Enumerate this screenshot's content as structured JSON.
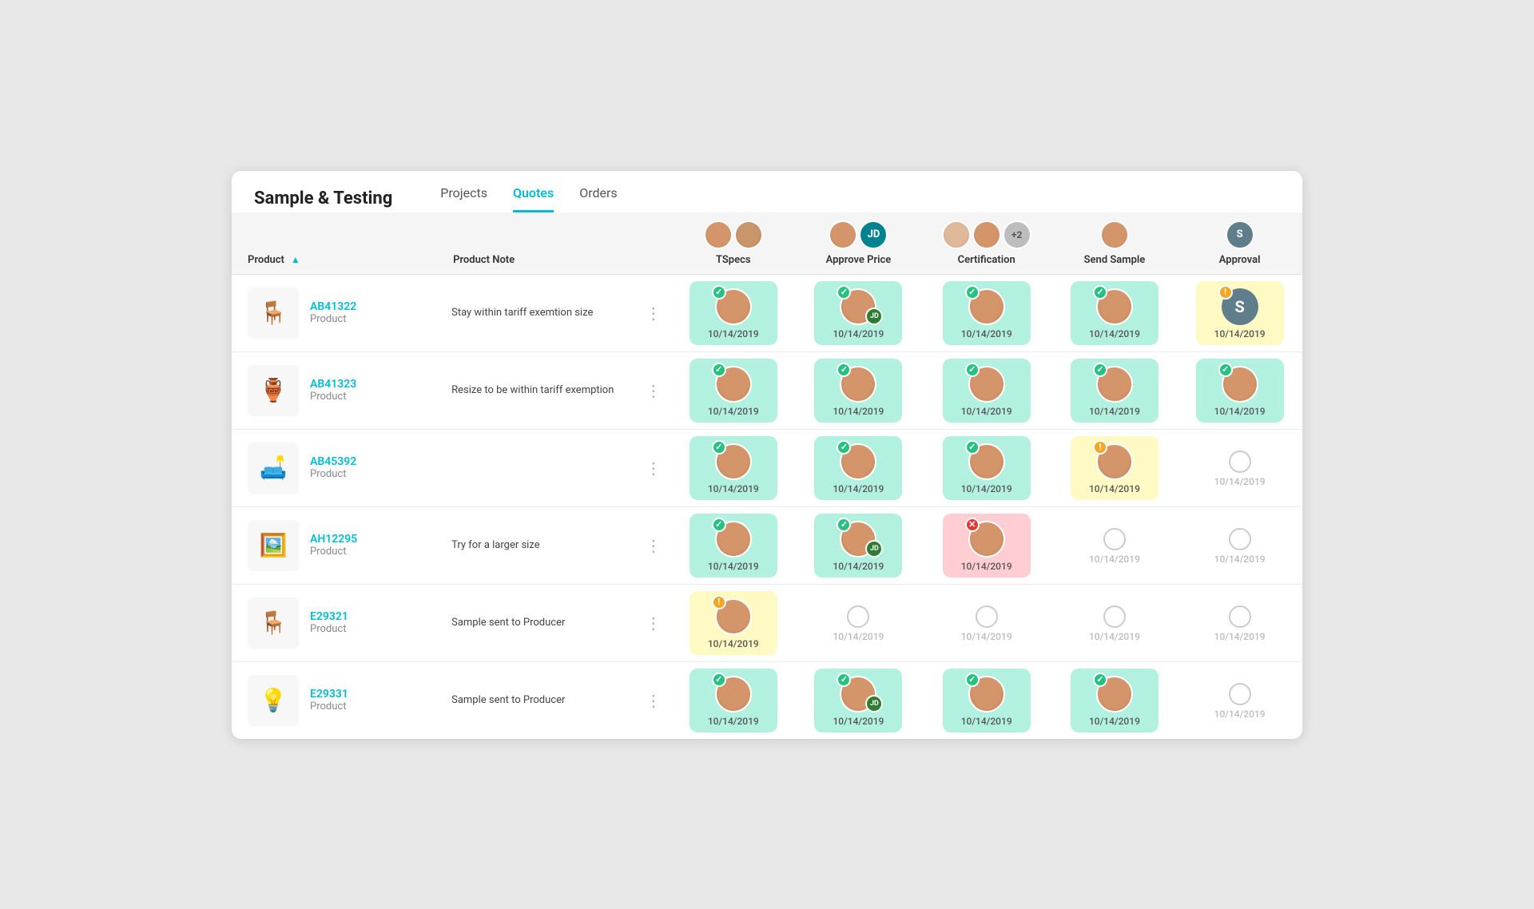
{
  "app": {
    "title": "Sample & Testing",
    "nav": [
      {
        "label": "Projects",
        "active": false
      },
      {
        "label": "Quotes",
        "active": true
      },
      {
        "label": "Orders",
        "active": false
      }
    ]
  },
  "columns": [
    {
      "key": "product",
      "label": "Product",
      "sortable": true
    },
    {
      "key": "note",
      "label": "Product Note"
    },
    {
      "key": "tspecs",
      "label": "TSpecs"
    },
    {
      "key": "approve_price",
      "label": "Approve Price"
    },
    {
      "key": "certification",
      "label": "Certification"
    },
    {
      "key": "send_sample",
      "label": "Send Sample"
    },
    {
      "key": "approval",
      "label": "Approval"
    }
  ],
  "date": "10/14/2019",
  "rows": [
    {
      "id": "AB41322",
      "type": "Product",
      "note": "Stay within tariff exemtion size",
      "icon": "🪑",
      "stages": {
        "tspecs": {
          "status": "done",
          "avatar": "woman1"
        },
        "approve_price": {
          "status": "done",
          "avatar": "woman1",
          "jd": true
        },
        "certification": {
          "status": "done",
          "avatar": "woman1"
        },
        "send_sample": {
          "status": "done",
          "avatar": "woman1"
        },
        "approval": {
          "status": "warn",
          "avatar": "s",
          "badge": "warn"
        }
      }
    },
    {
      "id": "AB41323",
      "type": "Product",
      "note": "Resize to be within tariff exemption",
      "icon": "🏺",
      "stages": {
        "tspecs": {
          "status": "done",
          "avatar": "woman1"
        },
        "approve_price": {
          "status": "done",
          "avatar": "woman1"
        },
        "certification": {
          "status": "done",
          "avatar": "woman1"
        },
        "send_sample": {
          "status": "done",
          "avatar": "woman1"
        },
        "approval": {
          "status": "done",
          "avatar": "woman1"
        }
      }
    },
    {
      "id": "AB45392",
      "type": "Product",
      "note": "",
      "icon": "🛋️",
      "stages": {
        "tspecs": {
          "status": "done",
          "avatar": "woman1"
        },
        "approve_price": {
          "status": "done",
          "avatar": "woman1"
        },
        "certification": {
          "status": "done",
          "avatar": "woman1"
        },
        "send_sample": {
          "status": "warn",
          "avatar": "woman1",
          "badge": "warn"
        },
        "approval": {
          "status": "empty"
        }
      }
    },
    {
      "id": "AH12295",
      "type": "Product",
      "note": "Try for a larger size",
      "icon": "🖼️",
      "stages": {
        "tspecs": {
          "status": "done",
          "avatar": "woman1"
        },
        "approve_price": {
          "status": "done",
          "avatar": "woman1",
          "jd": true
        },
        "certification": {
          "status": "error",
          "avatar": "woman1"
        },
        "send_sample": {
          "status": "empty"
        },
        "approval": {
          "status": "empty"
        }
      }
    },
    {
      "id": "E29321",
      "type": "Product",
      "note": "Sample sent to Producer",
      "icon": "🪑",
      "stages": {
        "tspecs": {
          "status": "warn",
          "avatar": "woman1",
          "badge": "warn"
        },
        "approve_price": {
          "status": "empty"
        },
        "certification": {
          "status": "empty"
        },
        "send_sample": {
          "status": "empty"
        },
        "approval": {
          "status": "empty"
        }
      }
    },
    {
      "id": "E29331",
      "type": "Product",
      "note": "Sample sent to Producer",
      "icon": "💡",
      "stages": {
        "tspecs": {
          "status": "done",
          "avatar": "woman1"
        },
        "approve_price": {
          "status": "done",
          "avatar": "woman1",
          "jd": true
        },
        "certification": {
          "status": "done",
          "avatar": "woman1"
        },
        "send_sample": {
          "status": "done",
          "avatar": "woman1"
        },
        "approval": {
          "status": "empty"
        }
      }
    }
  ],
  "labels": {
    "product_sort": "▲",
    "menu_dots": "⋮",
    "check": "✓",
    "warn": "!",
    "error": "✕"
  }
}
